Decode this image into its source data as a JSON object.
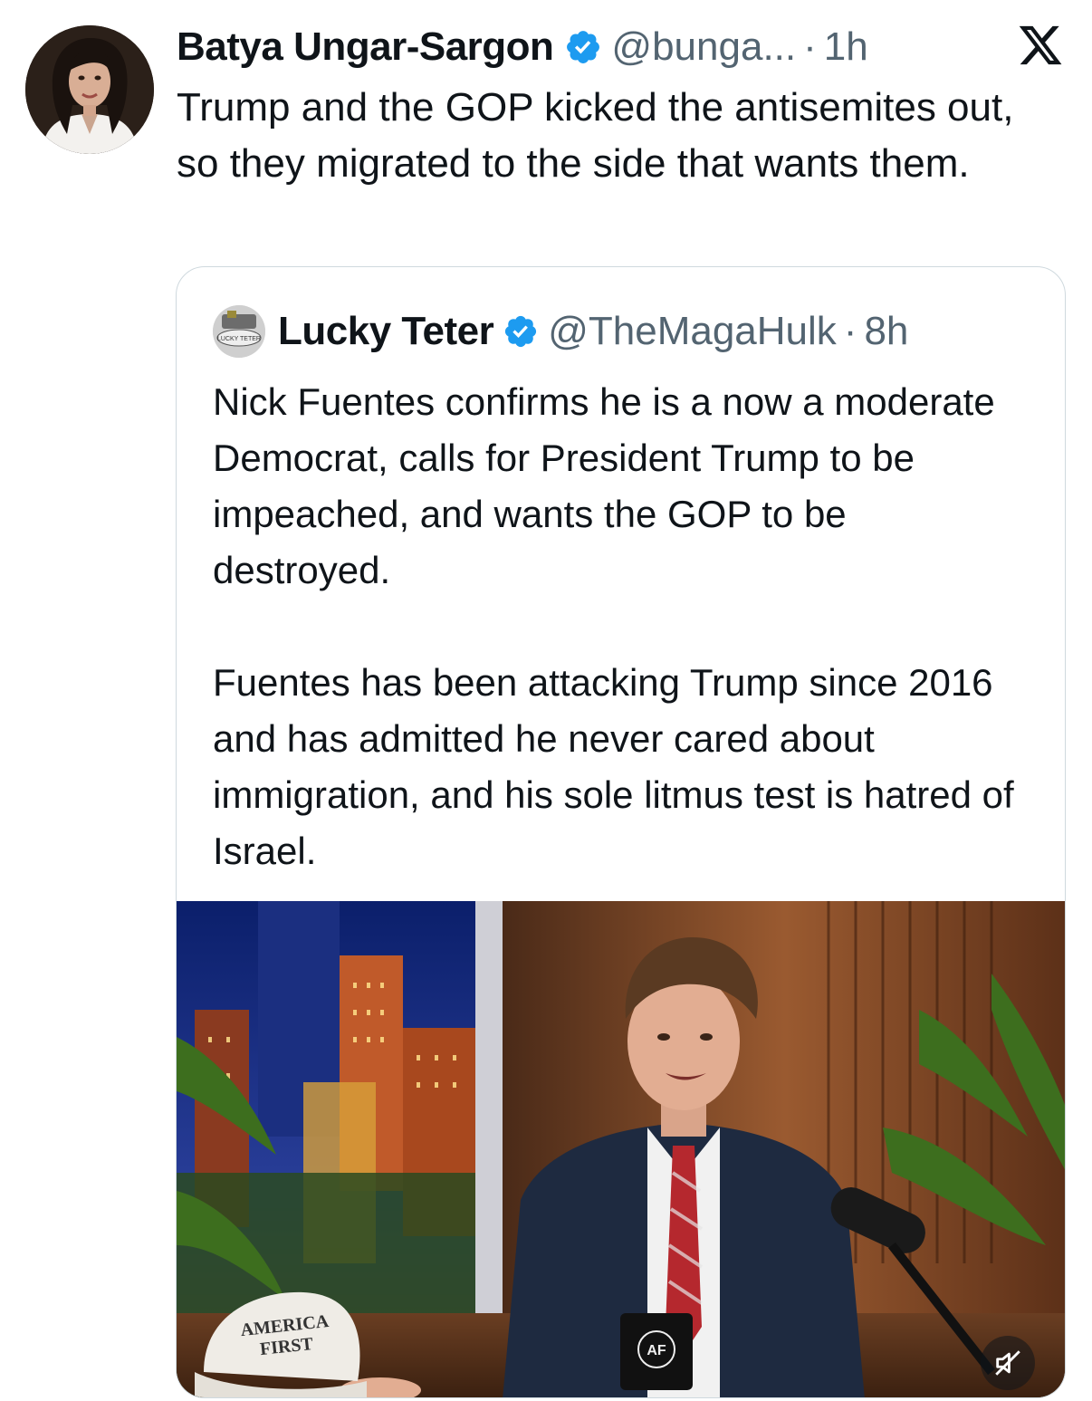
{
  "tweet": {
    "author_name": "Batya Ungar-Sargon",
    "author_handle": "@bunga...",
    "separator": "·",
    "time": "1h",
    "text": "Trump and the GOP kicked the antisemites out, so they migrated to the side that wants them.",
    "verified": true
  },
  "quoted_tweet": {
    "author_name": "Lucky Teter",
    "author_handle": "@TheMagaHulk",
    "separator": "·",
    "time": "8h",
    "verified": true,
    "avatar_text": "LUCKY TETER",
    "paragraphs": [
      "Nick Fuentes confirms he is a now a moderate Democrat, calls for President Trump to be impeached, and wants the GOP to be destroyed.",
      "Fuentes has been attacking Trump since 2016 and has admitted he never cared about immigration, and his sole litmus test is hatred of Israel."
    ],
    "media": {
      "hat_text_line1": "AMERICA",
      "hat_text_line2": "FIRST",
      "mug_text": "AF",
      "mute_icon": "speaker-muted-icon"
    }
  },
  "icons": {
    "verified": "verified-badge-icon",
    "platform": "x-logo-icon"
  },
  "colors": {
    "verified_blue": "#1d9bf0",
    "secondary_text": "#536471",
    "border": "#cfd9de"
  }
}
